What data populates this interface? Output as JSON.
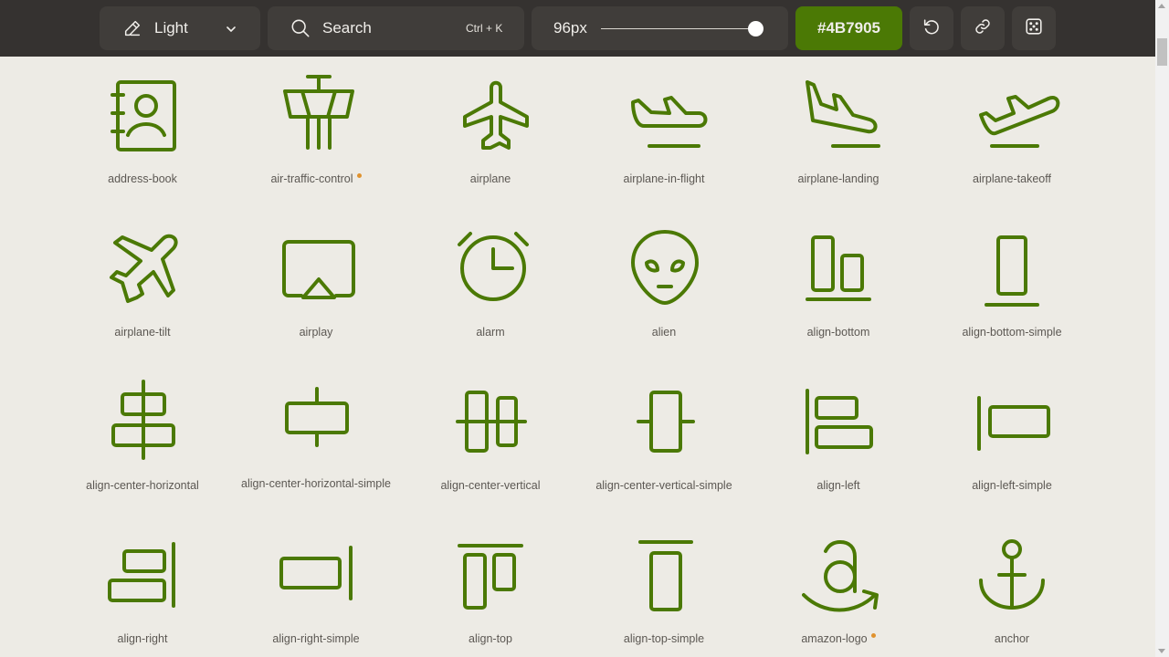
{
  "toolbar": {
    "weight": {
      "label": "Light",
      "icon": "pencil-icon"
    },
    "search": {
      "placeholder": "Search",
      "shortcut": "Ctrl + K"
    },
    "size": {
      "label": "96px",
      "slider_fraction": 0.98
    },
    "color": {
      "label": "#4B7905",
      "value": "#4B7905"
    },
    "buttons": [
      "reset-icon",
      "link-icon",
      "dice-icon"
    ]
  },
  "theme": {
    "background": "#EDEBE5",
    "toolbar": "#353230",
    "icon_color": "#4B7905",
    "new_badge": "#E0922E"
  },
  "icons": [
    {
      "name": "address-book",
      "new": false
    },
    {
      "name": "air-traffic-control",
      "new": true
    },
    {
      "name": "airplane",
      "new": false
    },
    {
      "name": "airplane-in-flight",
      "new": false
    },
    {
      "name": "airplane-landing",
      "new": false
    },
    {
      "name": "airplane-takeoff",
      "new": false
    },
    {
      "name": "airplane-tilt",
      "new": false
    },
    {
      "name": "airplay",
      "new": false
    },
    {
      "name": "alarm",
      "new": false
    },
    {
      "name": "alien",
      "new": false
    },
    {
      "name": "align-bottom",
      "new": false
    },
    {
      "name": "align-bottom-simple",
      "new": false
    },
    {
      "name": "align-center-horizontal",
      "new": false
    },
    {
      "name": "align-center-horizontal-simple",
      "new": false
    },
    {
      "name": "align-center-vertical",
      "new": false
    },
    {
      "name": "align-center-vertical-simple",
      "new": false
    },
    {
      "name": "align-left",
      "new": false
    },
    {
      "name": "align-left-simple",
      "new": false
    },
    {
      "name": "align-right",
      "new": false
    },
    {
      "name": "align-right-simple",
      "new": false
    },
    {
      "name": "align-top",
      "new": false
    },
    {
      "name": "align-top-simple",
      "new": false
    },
    {
      "name": "amazon-logo",
      "new": true
    },
    {
      "name": "anchor",
      "new": false
    }
  ]
}
